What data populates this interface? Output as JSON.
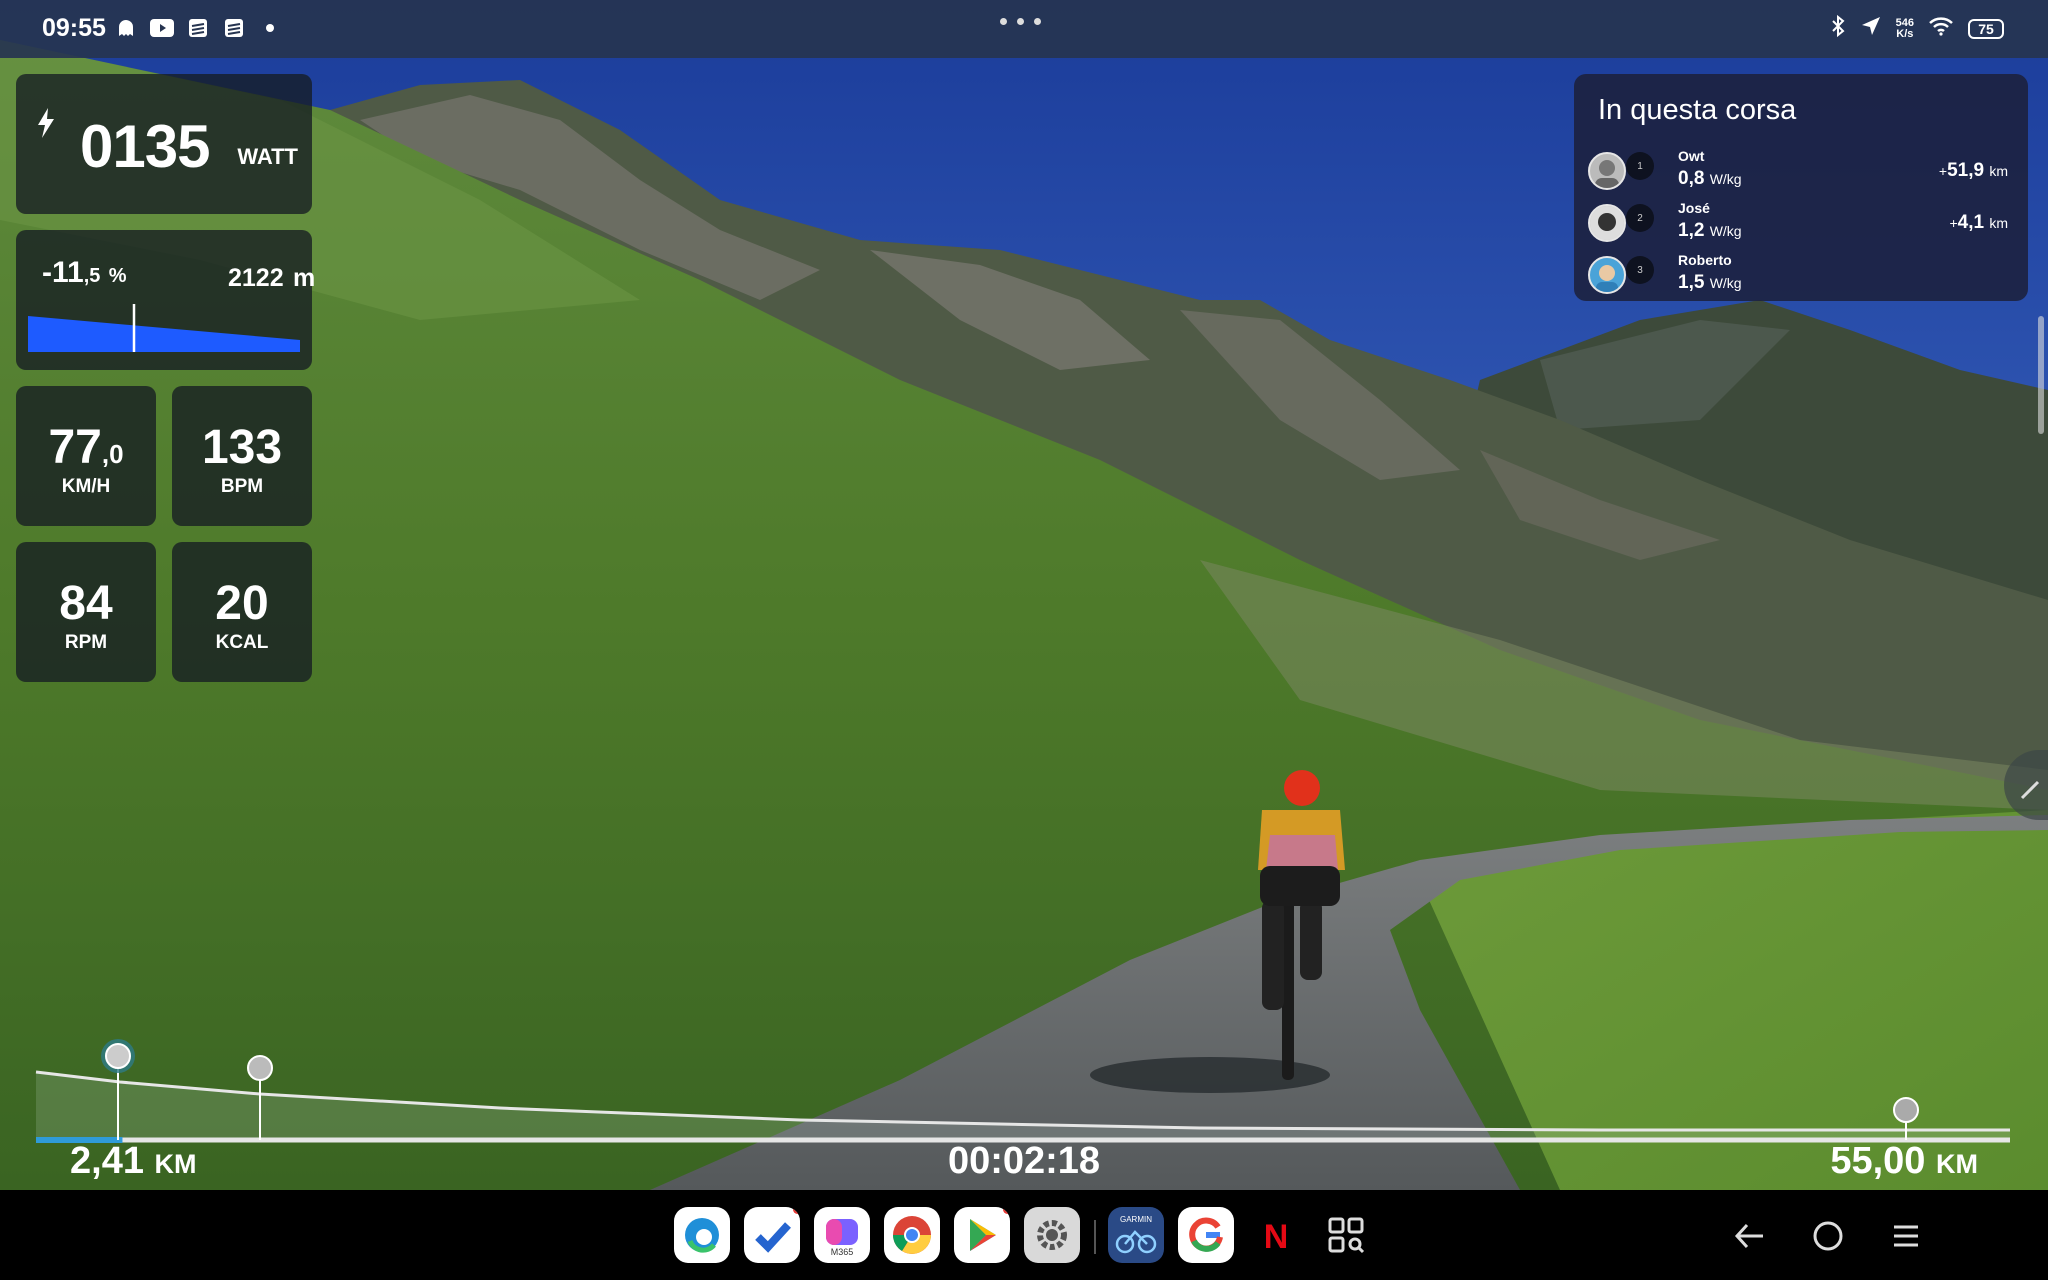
{
  "status_bar": {
    "time": "09:55",
    "net_speed_value": "546",
    "net_speed_unit": "K/s",
    "battery": "75"
  },
  "metrics": {
    "power": {
      "value": "0135",
      "unit": "WATT"
    },
    "grade": {
      "value": "-11",
      "decimal": ",5",
      "unit": "%"
    },
    "elevation": {
      "value": "2122",
      "unit": "m"
    },
    "speed": {
      "value": "77",
      "decimal": ",0",
      "unit": "KM/H"
    },
    "heart_rate": {
      "value": "133",
      "unit": "BPM"
    },
    "cadence": {
      "value": "84",
      "unit": "RPM"
    },
    "calories": {
      "value": "20",
      "unit": "KCAL"
    }
  },
  "ride_panel": {
    "title": "In questa corsa",
    "riders": [
      {
        "rank": "1",
        "name": "Owt",
        "wkg": "0,8",
        "wkg_unit": "W/kg",
        "gap_sign": "+",
        "gap": "51,9",
        "gap_unit": "km"
      },
      {
        "rank": "2",
        "name": "José",
        "wkg": "1,2",
        "wkg_unit": "W/kg",
        "gap_sign": "+",
        "gap": "4,1",
        "gap_unit": "km"
      },
      {
        "rank": "3",
        "name": "Roberto",
        "wkg": "1,5",
        "wkg_unit": "W/kg",
        "gap_sign": "",
        "gap": "",
        "gap_unit": ""
      }
    ]
  },
  "progress": {
    "current_distance": "2,41",
    "total_distance": "55,00",
    "distance_unit": "KM",
    "elapsed": "00:02:18",
    "fraction": 0.0438
  },
  "dock": {
    "apps": [
      "edge-icon",
      "to-do-icon",
      "m365-icon",
      "chrome-icon",
      "play-store-icon",
      "settings-icon",
      "garmin-icon",
      "google-icon",
      "netflix-icon",
      "app-drawer-icon"
    ],
    "m365_label": "M365",
    "garmin_label": "GARMIN",
    "netflix_label": "N"
  },
  "colors": {
    "accent_blue": "#1e5bff",
    "progress_blue": "#2f9bd9",
    "netflix_red": "#e50914"
  }
}
